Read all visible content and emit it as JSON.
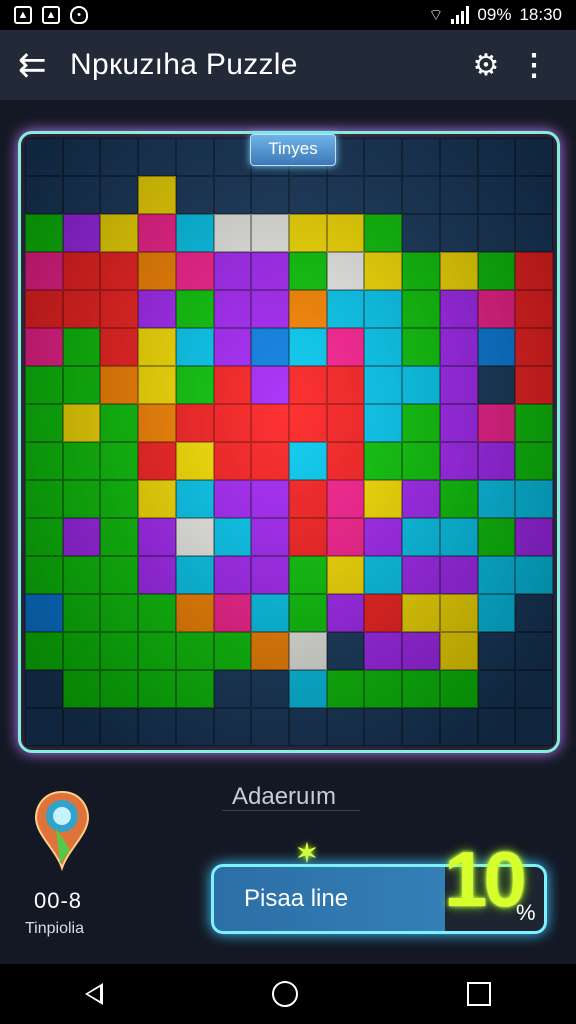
{
  "status": {
    "percent": "09%",
    "time": "18:30"
  },
  "header": {
    "title": "Npкuzıha Puzzle"
  },
  "board": {
    "tag": "Tinyes",
    "palette": [
      "#22c21f",
      "#ff2a2a",
      "#ffe21a",
      "#1fc6e8",
      "#9a2ee0",
      "#ff8a1a",
      "#f2f2ee",
      "#ff2a8a",
      "#1a7fd4",
      "#1e3a5a"
    ],
    "rows": [
      "99999999999999",
      "99929999999999",
      "04273662209999",
      "71157440620201",
      "11140445330471",
      "70123483730481",
      "00520141133491",
      "02051111130470",
      "00012113100440",
      "00023441724033",
      "04046341743304",
      "00043440234433",
      "80005730412239",
      "00000056944299",
      "90000993000099",
      "99999999999999"
    ]
  },
  "footer": {
    "caption": "Adaeruım",
    "score_value": "00-8",
    "score_label": "Tinpiolia",
    "action_label": "Pisaa line",
    "sparkle": "✶",
    "percent_value": "10",
    "percent_sign": "%"
  }
}
